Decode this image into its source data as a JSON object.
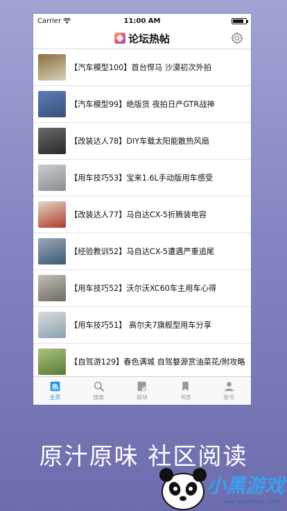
{
  "status_bar": {
    "carrier": "Carrier",
    "time": "11:00 AM",
    "battery_level": 0.85
  },
  "nav": {
    "title": "论坛热帖",
    "settings_icon": "gear-icon",
    "logo_icon": "app-logo-icon"
  },
  "posts": [
    {
      "title": "【汽车模型100】首台悍马 沙漠初次外拍",
      "thumb_colors": [
        "#d8d0b8",
        "#8a6e40"
      ]
    },
    {
      "title": "【汽车模型99】绝版货 夜拍日产GTR战神",
      "thumb_colors": [
        "#3a4f7a",
        "#5c7cb8"
      ]
    },
    {
      "title": "【改装达人78】DIY车载太阳能散热风扇",
      "thumb_colors": [
        "#2a2a2a",
        "#6a6a6a"
      ]
    },
    {
      "title": "【用车技巧53】宝来1.6L手动版用车感受",
      "thumb_colors": [
        "#8a8e92",
        "#c9ccd0"
      ]
    },
    {
      "title": "【改装达人77】马自达CX-5折腾装电容",
      "thumb_colors": [
        "#b23a2a",
        "#e0d6c8"
      ]
    },
    {
      "title": "【经验教训52】马自达CX-5遭遇严重追尾",
      "thumb_colors": [
        "#3b5a7a",
        "#9aa7b4"
      ]
    },
    {
      "title": "【用车技巧52】沃尔沃XC60车主用车心得",
      "thumb_colors": [
        "#6e6a62",
        "#c2beb6"
      ]
    },
    {
      "title": "【用车技巧51】  高尔夫7旗舰型用车分享",
      "thumb_colors": [
        "#8aa0b0",
        "#d8dcdc"
      ]
    },
    {
      "title": "【自驾游129】春色满城 自驾婺源赏油菜花/附攻略",
      "thumb_colors": [
        "#5a7a3a",
        "#a8c27a"
      ]
    }
  ],
  "tabs": [
    {
      "label": "主页",
      "icon": "hot-icon",
      "active": true
    },
    {
      "label": "搜索",
      "icon": "search-icon",
      "active": false
    },
    {
      "label": "版块",
      "icon": "board-icon",
      "active": false
    },
    {
      "label": "书签",
      "icon": "bookmark-icon",
      "active": false
    },
    {
      "label": "账号",
      "icon": "account-icon",
      "active": false
    }
  ],
  "slogan": "原汁原味 社区阅读",
  "watermark": {
    "brand": "小黑游戏",
    "url": "www.xiaohei.com",
    "mascot_icon": "panda-mascot-icon"
  },
  "colors": {
    "accent": "#1f8ef0",
    "inactive": "#9a9a9a",
    "background_top": "#a3a3d3",
    "background_bottom": "#6d6dad"
  }
}
